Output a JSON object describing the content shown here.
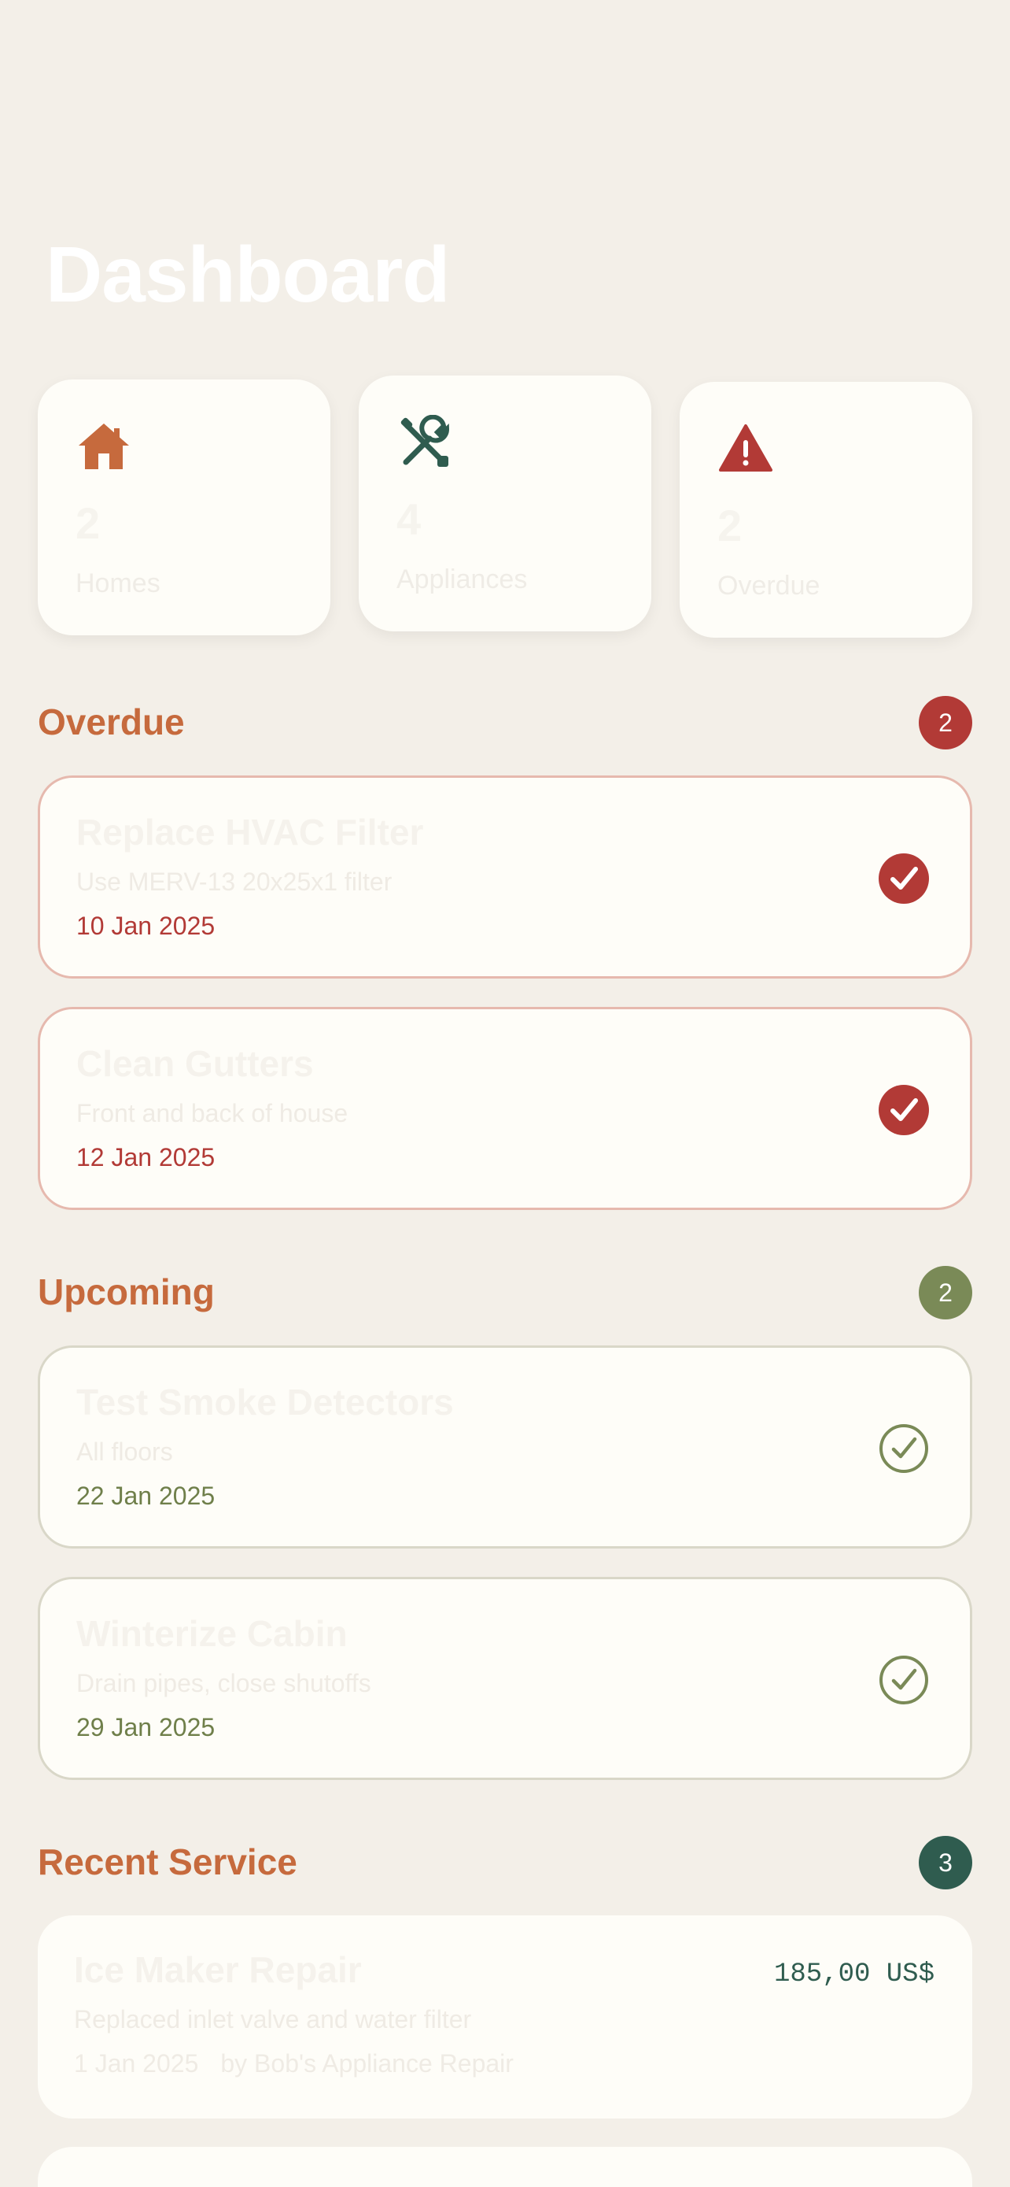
{
  "header": {
    "title": "Dashboard"
  },
  "stats": [
    {
      "icon": "house-icon",
      "value": "2",
      "label": "Homes"
    },
    {
      "icon": "tools-icon",
      "value": "4",
      "label": "Appliances"
    },
    {
      "icon": "warning-icon",
      "value": "2",
      "label": "Overdue"
    }
  ],
  "overdue": {
    "title": "Overdue",
    "count": "2",
    "items": [
      {
        "title": "Replace HVAC Filter",
        "subtitle": "Use MERV-13 20x25x1 filter",
        "date": "10 Jan 2025"
      },
      {
        "title": "Clean Gutters",
        "subtitle": "Front and back of house",
        "date": "12 Jan 2025"
      }
    ]
  },
  "upcoming": {
    "title": "Upcoming",
    "count": "2",
    "items": [
      {
        "title": "Test Smoke Detectors",
        "subtitle": "All floors",
        "date": "22 Jan 2025"
      },
      {
        "title": "Winterize Cabin",
        "subtitle": "Drain pipes, close shutoffs",
        "date": "29 Jan 2025"
      }
    ]
  },
  "recent": {
    "title": "Recent Service",
    "count": "3",
    "items": [
      {
        "title": "Ice Maker Repair",
        "subtitle": "Replaced inlet valve and water filter",
        "date": "1 Jan 2025",
        "by": "by Bob's Appliance Repair",
        "cost": "185,00 US$"
      }
    ]
  },
  "colors": {
    "accent": "#c66a3d",
    "overdue": "#b23a36",
    "upcoming": "#7a8a57",
    "service": "#2f5c4f",
    "background": "#f3efe8",
    "card": "#fefdf8"
  }
}
